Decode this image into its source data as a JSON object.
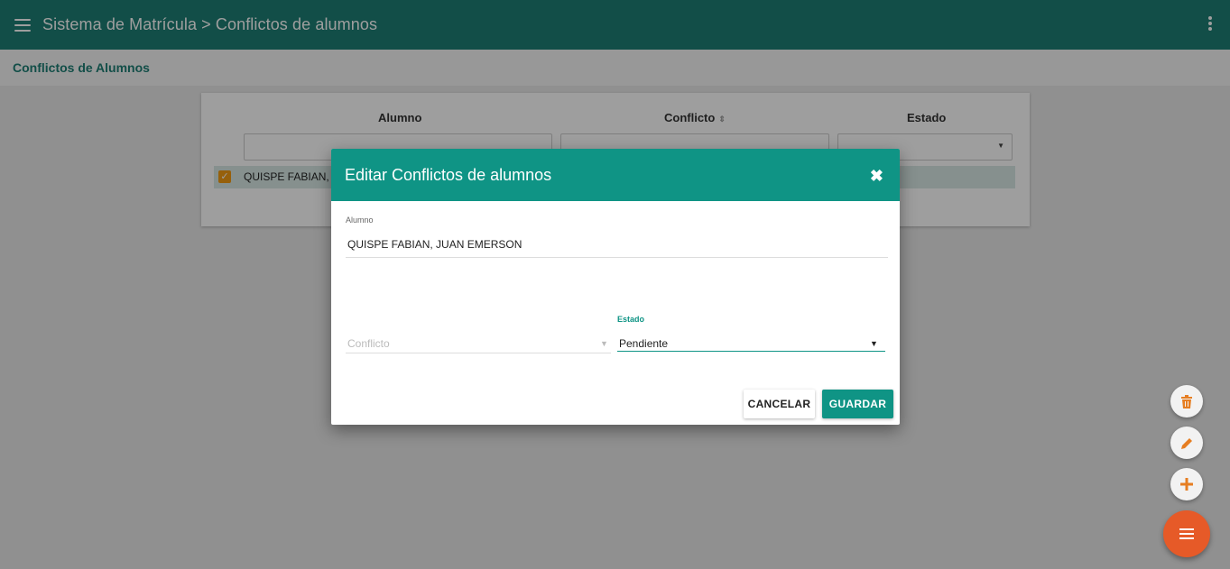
{
  "topbar": {
    "title": "Sistema de Matrícula > Conflictos de alumnos"
  },
  "subheader": {
    "title": "Conflictos de Alumnos"
  },
  "table": {
    "columns": [
      "Alumno",
      "Conflicto",
      "Estado"
    ],
    "sort_icon": "⇕",
    "rows": [
      {
        "alumno": "QUISPE FABIAN, J"
      }
    ]
  },
  "dialog": {
    "title": "Editar Conflictos de alumnos",
    "close_icon": "✖",
    "alumno": {
      "label": "Alumno",
      "value": "QUISPE FABIAN, JUAN EMERSON"
    },
    "conflicto": {
      "placeholder": "Conflicto"
    },
    "estado": {
      "label": "Estado",
      "value": "Pendiente"
    },
    "cancel_label": "CANCELAR",
    "save_label": "GUARDAR"
  },
  "fabs": [
    "trash-icon",
    "pencil-icon",
    "plus-icon",
    "menu-icon"
  ],
  "colors": {
    "primary": "#1e7f74",
    "dialog_header": "#0f9485",
    "accent_orange": "#e65a28",
    "checkbox": "#f39c12"
  }
}
